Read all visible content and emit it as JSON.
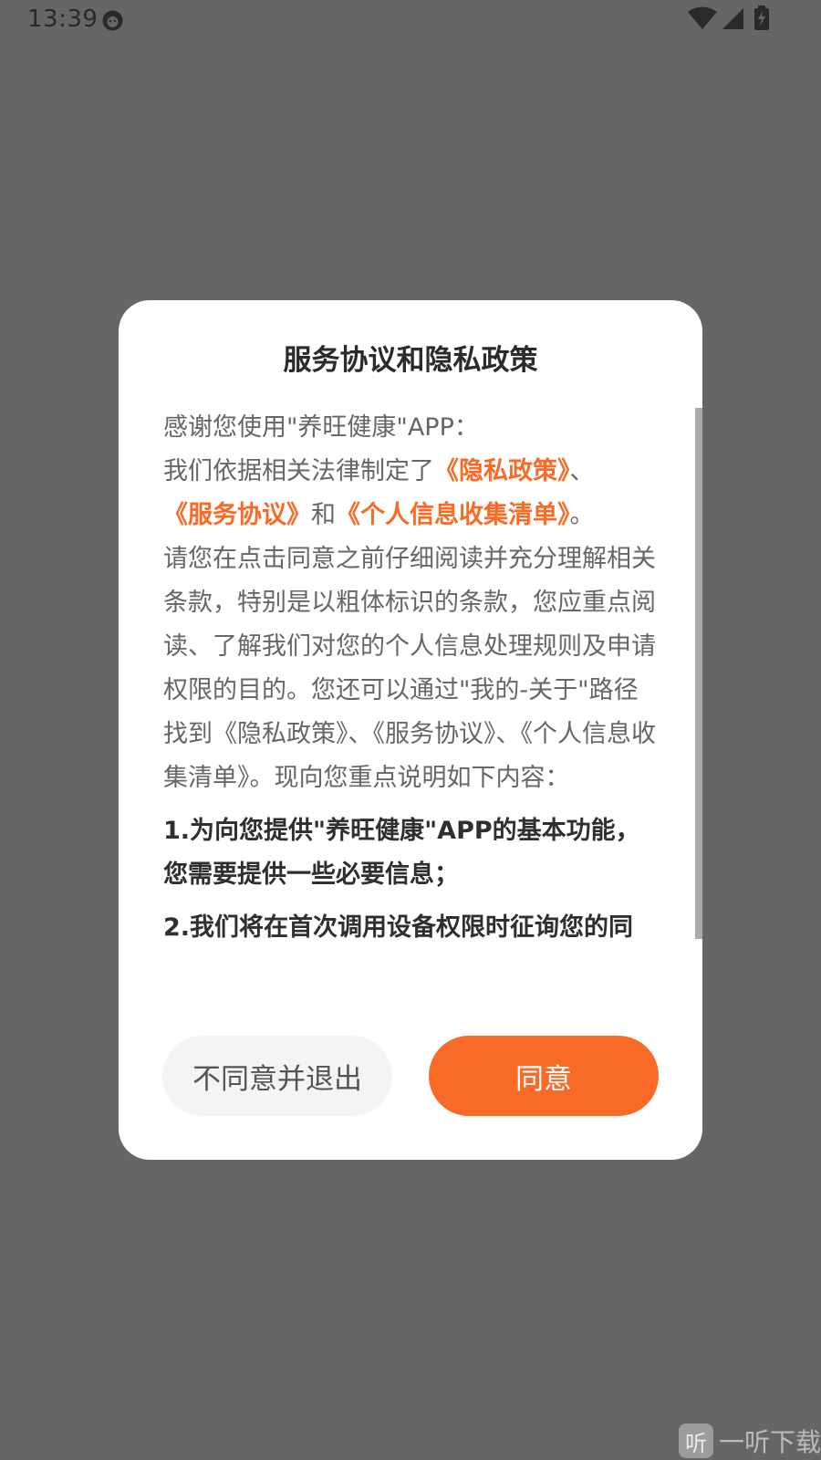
{
  "status_bar": {
    "time": "13:39",
    "icons": [
      "app-notification-icon",
      "wifi-icon",
      "cell-signal-icon",
      "battery-charging-icon"
    ]
  },
  "dialog": {
    "title": "服务协议和隐私政策",
    "intro": {
      "line1": "感谢您使用\"养旺健康\"APP：",
      "prefix": "我们依据相关法律制定了",
      "privacy_link": "《隐私政策》",
      "sep1": "、",
      "service_link": "《服务协议》",
      "and": "和",
      "info_link": "《个人信息收集清单》",
      "sep2": "。",
      "body": "请您在点击同意之前仔细阅读并充分理解相关条款，特别是以粗体标识的条款，您应重点阅读、了解我们对您的个人信息处理规则及申请权限的目的。您还可以通过\"我的-关于\"路径找到《隐私政策》、《服务协议》、《个人信息收集清单》。现向您重点说明如下内容："
    },
    "points": [
      "1.为向您提供\"养旺健康\"APP的基本功能，您需要提供一些必要信息；",
      "2.我们将在首次调用设备权限时征询您的同"
    ],
    "disagree_label": "不同意并退出",
    "agree_label": "同意"
  },
  "colors": {
    "overlay": "#666666",
    "accent": "#f86b27",
    "dialog_bg": "#ffffff",
    "disagree_bg": "#f4f4f4"
  },
  "watermark": {
    "badge": "听",
    "text": "一听下载"
  }
}
